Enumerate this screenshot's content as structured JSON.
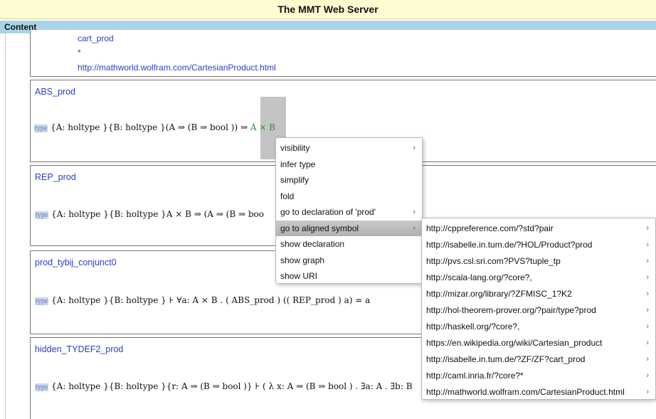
{
  "window": {
    "title": "The MMT Web Server"
  },
  "section": {
    "title": "Content"
  },
  "top_declaration": {
    "name": "cart_prod",
    "marker": "*",
    "url": "http://mathworld.wolfram.com/CartesianProduct.html"
  },
  "declarations": [
    {
      "name": "ABS_prod",
      "type_badge": "type",
      "type_expr": "{A: holtype }{B: holtype }(A ⇒ (B ⇒  bool )) ⇒",
      "type_tail": "A × B"
    },
    {
      "name": "REP_prod",
      "type_badge": "type",
      "type_expr": "{A: holtype }{B: holtype }A × B ⇒ (A ⇒ (B ⇒  boo"
    },
    {
      "name": "prod_tybij_conjunct0",
      "type_badge": "type",
      "type_expr": "{A: holtype }{B: holtype } ⊦ ∀a: A × B . ( ABS_prod  )  (( REP_prod  )  a) = a"
    },
    {
      "name": "hidden_TYDEF2_prod",
      "type_badge": "type",
      "type_expr": "{A: holtype }{B: holtype }{r: A ⇒ (B ⇒  bool )} ⊦ ( λ  x: A ⇒ (B ⇒  bool ) . ∃a: A . ∃b: B"
    }
  ],
  "context_menu": {
    "items": [
      {
        "label": "visibility",
        "submenu": true
      },
      {
        "label": "infer type",
        "submenu": false
      },
      {
        "label": "simplify",
        "submenu": false
      },
      {
        "label": "fold",
        "submenu": false
      },
      {
        "label": "go to declaration of 'prod'",
        "submenu": true
      },
      {
        "label": "go to aligned symbol",
        "submenu": true,
        "active": true
      },
      {
        "label": "show declaration",
        "submenu": false
      },
      {
        "label": "show graph",
        "submenu": false
      },
      {
        "label": "show URI",
        "submenu": false
      }
    ]
  },
  "aligned_submenu": {
    "items": [
      "http://cppreference.com/?std?pair",
      "http://isabelle.in.tum.de/?HOL/Product?prod",
      "http://pvs.csl.sri.com?PVS?tuple_tp",
      "http://scala-lang.org/?core?,",
      "http://mizar.org/library/?ZFMISC_1?K2",
      "http://hol-theorem-prover.org/?pair/type?prod",
      "http://haskell.org/?core?,",
      "https://en.wikipedia.org/wiki/Cartesian_product",
      "http://isabelle.in.tum.de/?ZF/ZF?cart_prod",
      "http://caml.inria.fr/?core?*",
      "http://mathworld.wolfram.com/CartesianProduct.html"
    ]
  },
  "icons": {
    "submenu_arrow": "chevron-right-icon"
  },
  "colors": {
    "title_bg": "#fdfbd0",
    "header_bg": "#a9d4e8",
    "link": "#2b3ec4",
    "type_green": "#2f8a2f"
  }
}
